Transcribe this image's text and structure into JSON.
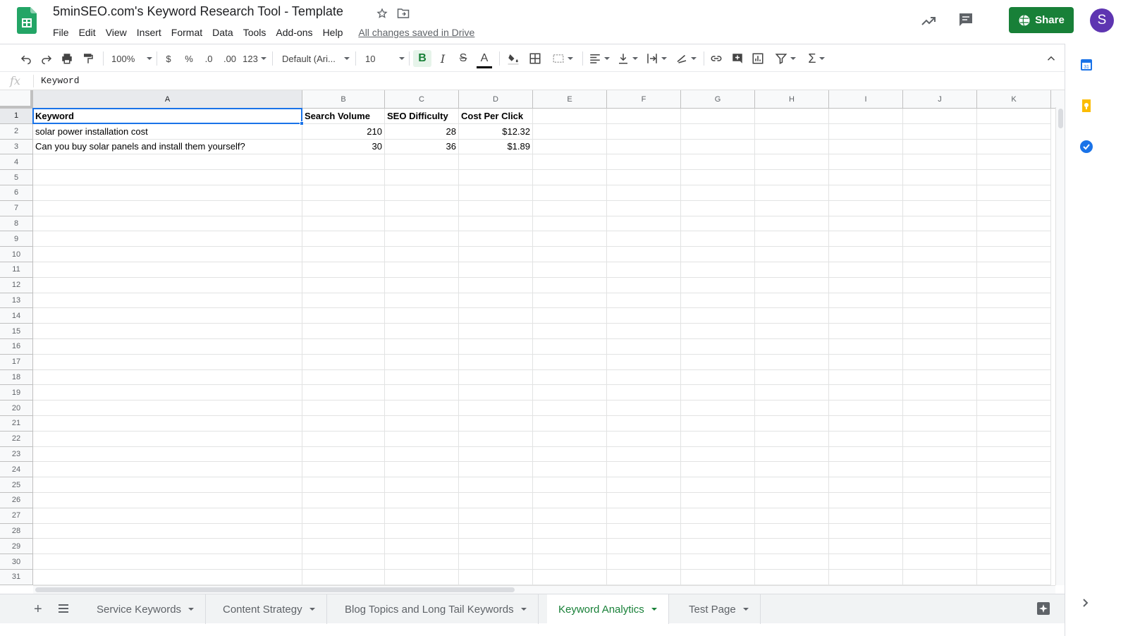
{
  "app": {
    "doc_title": "5minSEO.com's Keyword  Research Tool - Template",
    "saved_status": "All changes saved in Drive",
    "share_label": "Share",
    "avatar_letter": "S"
  },
  "menu": [
    "File",
    "Edit",
    "View",
    "Insert",
    "Format",
    "Data",
    "Tools",
    "Add-ons",
    "Help"
  ],
  "toolbar": {
    "zoom": "100%",
    "currency": "$",
    "percent": "%",
    "decrease_decimal": ".0",
    "increase_decimal": ".00",
    "more_formats": "123",
    "font": "Default (Ari...",
    "font_size": "10",
    "bold": "B",
    "italic": "I",
    "strike": "S",
    "text_color": "A",
    "sum": "Σ"
  },
  "formula_bar": {
    "fx": "fx",
    "value": "Keyword"
  },
  "columns": [
    "A",
    "B",
    "C",
    "D",
    "E",
    "F",
    "G",
    "H",
    "I",
    "J",
    "K"
  ],
  "rows": [
    "1",
    "2",
    "3",
    "4",
    "5",
    "6",
    "7",
    "8",
    "9",
    "10",
    "11",
    "12",
    "13",
    "14",
    "15",
    "16",
    "17",
    "18",
    "19",
    "20",
    "21",
    "22",
    "23",
    "24",
    "25",
    "26",
    "27",
    "28",
    "29",
    "30",
    "31"
  ],
  "cells": {
    "A1": "Keyword",
    "B1": "Search Volume",
    "C1": "SEO Difficulty",
    "D1": "Cost Per Click",
    "A2": "solar power installation cost",
    "B2": "210",
    "C2": "28",
    "D2": "$12.32",
    "A3": "Can you buy solar panels and install them yourself?",
    "B3": "30",
    "C3": "36",
    "D3": "$1.89"
  },
  "tabs": [
    {
      "label": "Service Keywords",
      "active": false
    },
    {
      "label": "Content Strategy",
      "active": false
    },
    {
      "label": "Blog Topics and Long Tail Keywords",
      "active": false
    },
    {
      "label": "Keyword Analytics",
      "active": true
    },
    {
      "label": "Test Page",
      "active": false
    }
  ],
  "tab_controls": {
    "add": "+"
  },
  "colors": {
    "brand_green": "#188038",
    "selection_blue": "#1a73e8",
    "avatar_purple": "#5e35b1"
  }
}
